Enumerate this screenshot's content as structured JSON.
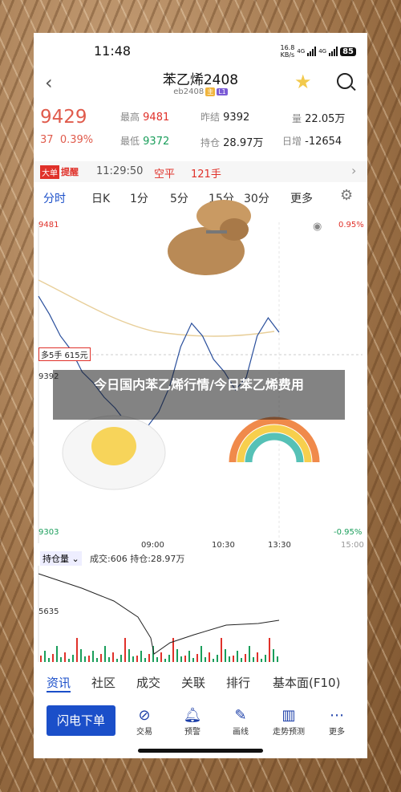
{
  "status": {
    "time": "11:48",
    "net_speed": "16.8\nKB/s",
    "net_speed_top": "16.8",
    "net_speed_bottom": "KB/s",
    "sim1": "4G",
    "sim2": "4G",
    "battery": "85"
  },
  "header": {
    "title": "苯乙烯2408",
    "code": "eb2408",
    "tag1": "主",
    "tag2": "L1"
  },
  "quote": {
    "price": "9429",
    "change": "37",
    "change_pct": "0.39%",
    "high_label": "最高",
    "high": "9481",
    "low_label": "最低",
    "low": "9372",
    "prev_label": "昨结",
    "prev": "9392",
    "hold_label": "持仓",
    "hold": "28.97万",
    "vol_label": "量",
    "vol": "22.05万",
    "day_label": "日增",
    "day": "-12654"
  },
  "alert": {
    "badge_a": "大单",
    "badge_b": "提醒",
    "time": "11:29:50",
    "kind": "空平",
    "qty": "121手"
  },
  "tabs": [
    "分时",
    "日K",
    "1分",
    "5分",
    "15分",
    "30分",
    "更多"
  ],
  "chart": {
    "y_top": "9481",
    "y_top_pct": "0.95%",
    "y_mid": "9392",
    "y_bottom": "9303",
    "y_bottom_pct": "-0.95%",
    "box_label": "多5手 615元",
    "times": [
      "09:00",
      "10:30",
      "13:30",
      "15:00"
    ]
  },
  "overlay": {
    "text": "今日国内苯乙烯行情/今日苯乙烯费用"
  },
  "vol": {
    "selector": "持仓量",
    "info": "成交:606 持仓:28.97万",
    "y_label": "5635"
  },
  "bottom_tabs": [
    "资讯",
    "社区",
    "成交",
    "关联",
    "排行",
    "基本面(F10)"
  ],
  "toolbar": {
    "flash": "闪电下单",
    "items": [
      "交易",
      "预警",
      "画线",
      "走势预测",
      "更多"
    ]
  },
  "colors": {
    "accent": "#1b4fc9",
    "up": "#e0312a",
    "down": "#1a9e5b",
    "line": "#2a4f9c",
    "avg": "#e8cf9a"
  },
  "chart_data": {
    "type": "line",
    "x": [
      "09:00",
      "10:30",
      "13:30",
      "15:00"
    ],
    "series": [
      {
        "values": [
          9440,
          9430,
          9418,
          9410,
          9398,
          9392,
          9384,
          9378,
          9370,
          9365,
          9368,
          9376,
          9390,
          9412,
          9425,
          9418,
          9405,
          9398,
          9388,
          9395,
          9418,
          9428,
          9420
        ]
      }
    ],
    "ylim": [
      9303,
      9481
    ]
  }
}
